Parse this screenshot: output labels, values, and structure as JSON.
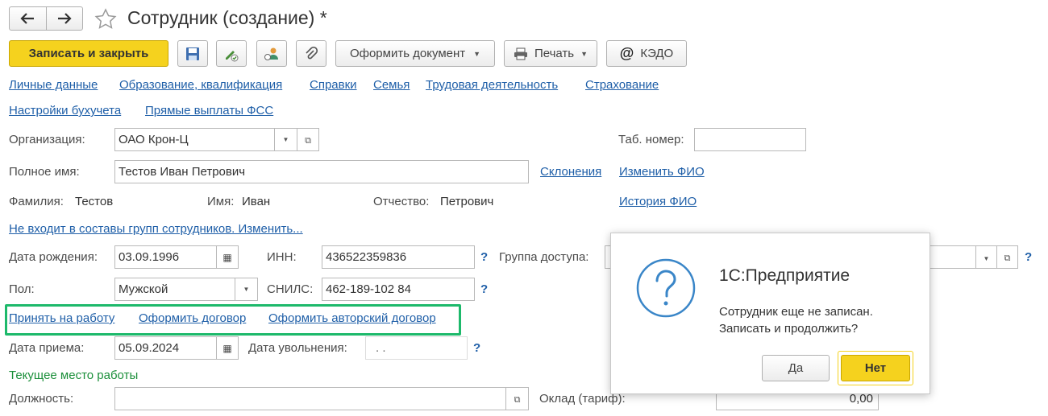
{
  "window": {
    "title": "Сотрудник (создание) *"
  },
  "toolbar": {
    "save_close_label": "Записать и закрыть",
    "issue_document_label": "Оформить документ",
    "print_label": "Печать",
    "kedo_label": "КЭДО"
  },
  "nav_links": {
    "row1": [
      "Личные данные",
      "Образование, квалификация",
      "Справки",
      "Семья",
      "Трудовая деятельность",
      "Страхование"
    ],
    "row2": [
      "Настройки бухучета",
      "Прямые выплаты ФСС"
    ]
  },
  "form": {
    "organization_label": "Организация:",
    "organization_value": "ОАО Крон-Ц",
    "tab_number_label": "Таб. номер:",
    "tab_number_value": "",
    "full_name_label": "Полное имя:",
    "full_name_value": "Тестов Иван Петрович",
    "declensions_link": "Склонения",
    "change_name_link": "Изменить ФИО",
    "surname_label": "Фамилия:",
    "surname_value": "Тестов",
    "firstname_label": "Имя:",
    "firstname_value": "Иван",
    "patronymic_label": "Отчество:",
    "patronymic_value": "Петрович",
    "name_history_link": "История ФИО",
    "groups_link": "Не входит в составы групп сотрудников. Изменить...",
    "birth_date_label": "Дата рождения:",
    "birth_date_value": "03.09.1996",
    "inn_label": "ИНН:",
    "inn_value": "436522359836",
    "access_group_label": "Группа доступа:",
    "gender_label": "Пол:",
    "gender_value": "Мужской",
    "snils_label": "СНИЛС:",
    "snils_value": "462-189-102 84",
    "question_mark": "?",
    "hire_date_label": "Дата приема:",
    "hire_date_value": "05.09.2024",
    "dismissal_date_label": "Дата увольнения:",
    "dismissal_date_value": " .  .",
    "current_workplace_label": "Текущее место работы",
    "position_label": "Должность:",
    "position_value": "",
    "salary_label": "Оклад (тариф):",
    "salary_value": "0,00"
  },
  "action_links": [
    "Принять на работу",
    "Оформить договор",
    "Оформить авторский договор"
  ],
  "dialog": {
    "title": "1С:Предприятие",
    "message_line1": "Сотрудник еще не записан.",
    "message_line2": "Записать и продолжить?",
    "yes_label": "Да",
    "no_label": "Нет"
  },
  "colors": {
    "primary_button": "#f5d21e",
    "link": "#1f5fa8",
    "highlight_frame": "#1db96b",
    "section_green": "#1b8f3a",
    "dialog_icon": "#3a86c8"
  }
}
